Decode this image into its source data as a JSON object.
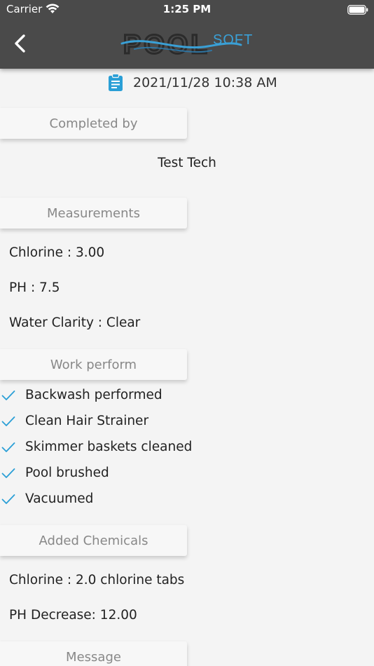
{
  "status_bar": {
    "carrier": "Carrier",
    "time": "1:25 PM"
  },
  "header": {
    "logo_main": "POOL",
    "logo_accent": "SOFT",
    "back_icon": "chevron-left-icon"
  },
  "colors": {
    "header_bg": "#4a4a4a",
    "accent": "#2a9fd6",
    "section_bg": "#f7f7f7",
    "page_bg": "#f4f4f4"
  },
  "report": {
    "datetime": "2021/11/28 10:38 AM",
    "completed_by": {
      "heading": "Completed by",
      "name": "Test Tech"
    },
    "measurements": {
      "heading": "Measurements",
      "items": [
        "Chlorine : 3.00",
        "PH : 7.5",
        "Water Clarity : Clear"
      ]
    },
    "work_performed": {
      "heading": "Work perform",
      "items": [
        "Backwash performed",
        "Clean Hair Strainer",
        "Skimmer baskets cleaned",
        "Pool brushed",
        "Vacuumed"
      ]
    },
    "added_chemicals": {
      "heading": "Added Chemicals",
      "items": [
        "Chlorine : 2.0 chlorine tabs",
        "PH Decrease: 12.00"
      ]
    },
    "message": {
      "heading": "Message"
    }
  }
}
